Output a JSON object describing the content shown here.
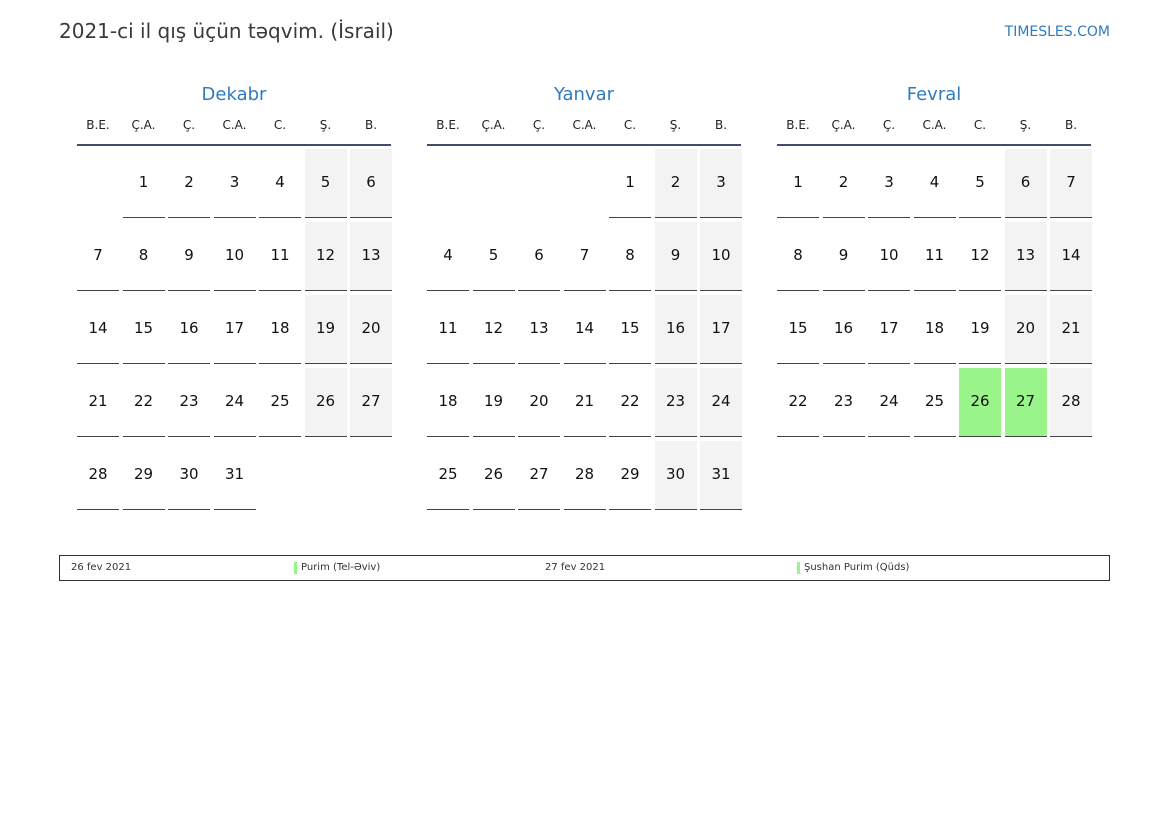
{
  "title": "2021-ci il qış üçün təqvim. (İsrail)",
  "site": "TIMESLES.COM",
  "colors": {
    "accent": "#2f7bbf",
    "weekend_bg": "#f3f3f3",
    "holiday_bg": "#99f58a"
  },
  "weekdays": [
    "B.E.",
    "Ç.A.",
    "Ç.",
    "C.A.",
    "C.",
    "Ş.",
    "B."
  ],
  "months": [
    {
      "name": "Dekabr",
      "first_weekday": 1,
      "days_count": 31,
      "holidays": []
    },
    {
      "name": "Yanvar",
      "first_weekday": 4,
      "days_count": 31,
      "holidays": []
    },
    {
      "name": "Fevral",
      "first_weekday": 0,
      "days_count": 28,
      "holidays": [
        26,
        27
      ]
    }
  ],
  "legend": [
    {
      "date": "26 fev 2021",
      "name": "Purim (Tel-Əviv)"
    },
    {
      "date": "27 fev 2021",
      "name": "Şushan Purim (Qüds)"
    }
  ]
}
